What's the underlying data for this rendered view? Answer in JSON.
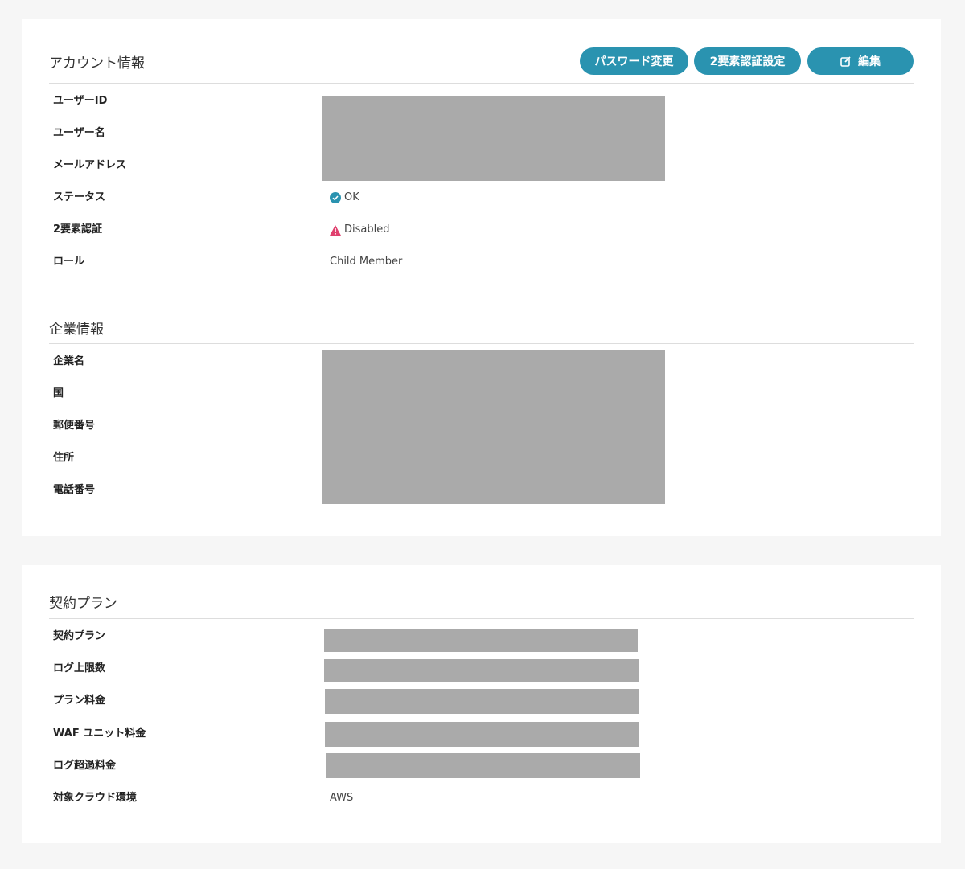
{
  "account": {
    "title": "アカウント情報",
    "buttons": {
      "password": "パスワード変更",
      "twofa": "2要素認証設定",
      "edit": "編集"
    },
    "rows": [
      {
        "label": "ユーザーID"
      },
      {
        "label": "ユーザー名"
      },
      {
        "label": "メールアドレス"
      },
      {
        "label": "ステータス",
        "value": "OK"
      },
      {
        "label": "2要素認証",
        "value": "Disabled"
      },
      {
        "label": "ロール",
        "value": "Child Member"
      }
    ]
  },
  "company": {
    "title": "企業情報",
    "rows": [
      {
        "label": "企業名"
      },
      {
        "label": "国"
      },
      {
        "label": "郵便番号"
      },
      {
        "label": "住所"
      },
      {
        "label": "電話番号"
      }
    ]
  },
  "plan": {
    "title": "契約プラン",
    "rows": [
      {
        "label": "契約プラン"
      },
      {
        "label": "ログ上限数"
      },
      {
        "label": "プラン料金"
      },
      {
        "label": "WAF ユニット料金"
      },
      {
        "label": "ログ超過料金"
      },
      {
        "label": "対象クラウド環境",
        "value": "AWS"
      }
    ]
  },
  "colors": {
    "accent": "#2a93b0",
    "warning": "#e0406e",
    "redaction": "#aaaaaa"
  }
}
